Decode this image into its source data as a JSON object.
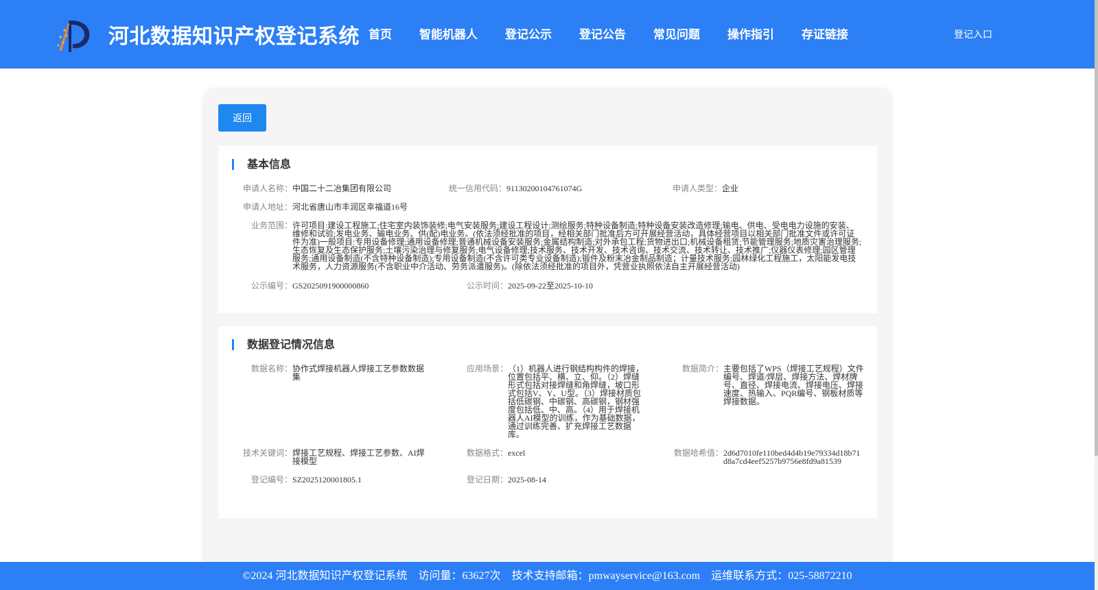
{
  "header": {
    "title": "河北数据知识产权登记系统",
    "nav": [
      "首页",
      "智能机器人",
      "登记公示",
      "登记公告",
      "常见问题",
      "操作指引",
      "存证链接"
    ],
    "login": "登记入口"
  },
  "back_label": "返回",
  "basic": {
    "title": "基本信息",
    "applicant_name_label": "申请人名称：",
    "applicant_name": "中国二十二冶集团有限公司",
    "credit_code_label": "统一信用代码：",
    "credit_code": "91130200104761074G",
    "applicant_type_label": "申请人类型：",
    "applicant_type": "企业",
    "address_label": "申请人地址：",
    "address": "河北省唐山市丰润区幸福道16号",
    "scope_label": "业务范围：",
    "scope": "许可项目:建设工程施工;住宅室内装饰装修;电气安装服务;建设工程设计;测绘服务;特种设备制造;特种设备安装改造修理;输电、供电、受电电力设施的安装、维修和试验;发电业务、输电业务、供(配)电业务。(依法须经批准的项目，经相关部门批准后方可开展经营活动，具体经营项目以相关部门批准文件或许可证件为准)一般项目:专用设备修理;通用设备修理;普通机械设备安装服务;金属结构制造;对外承包工程;货物进出口;机械设备租赁;节能管理服务;地质灾害治理服务;生态恢复及生态保护服务;土壤污染治理与修复服务;电气设备修理;技术服务、技术开发、技术咨询、技术交流、技术转让、技术推广;仪器仪表修理;园区管理服务;通用设备制造(不含特种设备制造);专用设备制造(不含许可类专业设备制造);锻件及粉末冶金制品制造；计量技术服务;园林绿化工程施工，太阳能发电技术服务，人力资源服务(不含职业中介活动、劳务派遣服务)。(除依法须经批准的项目外，凭营业执照依法自主开展经营活动)",
    "pub_no_label": "公示编号：",
    "pub_no": "GS2025091900000860",
    "pub_time_label": "公示时间：",
    "pub_time": "2025-09-22至2025-10-10"
  },
  "reg": {
    "title": "数据登记情况信息",
    "data_name_label": "数据名称：",
    "data_name": "协作式焊接机器人焊接工艺参数数据集",
    "scene_label": "应用场景：",
    "scene": "（1）机器人进行钢结构构件的焊接，位置包括平、横、立、仰。（2）焊缝形式包括对接焊缝和角焊缝，坡口形式包括V、Y、U型。（3）焊接材质包括低碳钢、中碳钢、高碳钢，钢材强度包括低、中、高。（4）用于焊接机器人AI模型的训练，作为基础数据，通过训练完善、扩充焊接工艺数据库。",
    "intro_label": "数据简介：",
    "intro": "主要包括了WPS（焊接工艺规程）文件编号、焊道/焊层、焊接方法、焊材牌号、直径、焊接电流、焊接电压、焊接速度、热输入、PQR编号、钢板材质等焊接数据。",
    "keywords_label": "技术关键词：",
    "keywords": "焊接工艺规程、焊接工艺参数、AI焊接模型",
    "format_label": "数据格式：",
    "format": "excel",
    "hash_label": "数据哈希值：",
    "hash": "2d6d7010fe110bed4d4b19e79334d18b71d8a7cd4eef5257b9756e8fd9a81539",
    "reg_no_label": "登记编号：",
    "reg_no": "SZ2025120001805.1",
    "reg_date_label": "登记日期：",
    "reg_date": "2025-08-14"
  },
  "footer": {
    "copyright": "©2024 河北数据知识产权登记系统",
    "visits": "访问量：63627次",
    "email": "技术支持邮箱：pmwayservice@163.com",
    "phone": "运维联系方式：025-58872210"
  }
}
